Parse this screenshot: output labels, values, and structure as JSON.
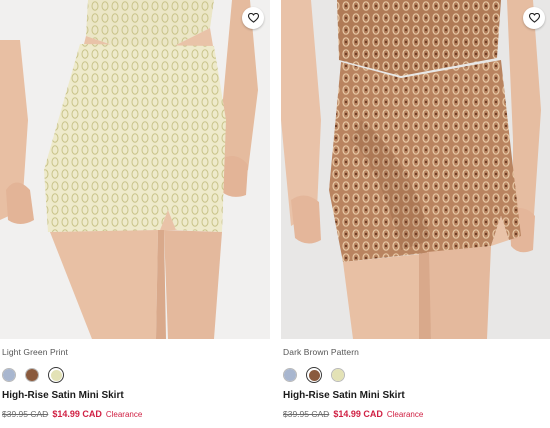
{
  "products": [
    {
      "color_name": "Light Green Print",
      "title": "High-Rise Satin Mini Skirt",
      "price_was": "$39.95 CAD",
      "price_now": "$14.99 CAD",
      "badge": "Clearance",
      "swatches": [
        {
          "name": "blue print",
          "color": "#a8b6cf",
          "selected": false
        },
        {
          "name": "brown pattern",
          "color": "#8a5a3d",
          "selected": false
        },
        {
          "name": "light green print",
          "color": "#e3e2b6",
          "selected": true
        }
      ]
    },
    {
      "color_name": "Dark Brown Pattern",
      "title": "High-Rise Satin Mini Skirt",
      "price_was": "$39.95 CAD",
      "price_now": "$14.99 CAD",
      "badge": "Clearance",
      "swatches": [
        {
          "name": "blue print",
          "color": "#a8b6cf",
          "selected": false
        },
        {
          "name": "brown pattern",
          "color": "#8a5a3d",
          "selected": true
        },
        {
          "name": "light green print",
          "color": "#e3e2b6",
          "selected": false
        }
      ]
    }
  ],
  "colors": {
    "sale_red": "#d02043",
    "skin": "#e9c3a8",
    "skirt_green": "#ebe7c3",
    "skirt_brown": "#b9835f"
  },
  "icons": {
    "wishlist": "heart-outline-icon"
  }
}
